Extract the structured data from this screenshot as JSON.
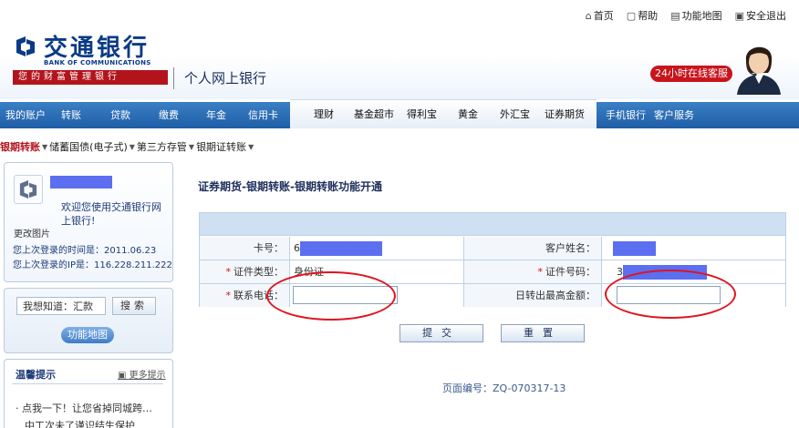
{
  "toplinks": [
    {
      "icon": "home-icon",
      "glyph": "⌂",
      "label": "首页"
    },
    {
      "icon": "help-icon",
      "glyph": "▢",
      "label": "帮助"
    },
    {
      "icon": "map-icon",
      "glyph": "▤",
      "label": "功能地图"
    },
    {
      "icon": "logout-icon",
      "glyph": "▣",
      "label": "安全退出"
    }
  ],
  "brand": {
    "name_cn": "交通银行",
    "name_en": "BANK OF COMMUNICATIONS",
    "slogan": "您的财富管理银行",
    "site_title": "个人网上银行",
    "online_service": "24小时在线客服",
    "brand_color": "#0a3a86",
    "accent_color": "#c8141c"
  },
  "nav": {
    "left": [
      "我的账户",
      "转账",
      "贷款",
      "缴费",
      "年金",
      "信用卡"
    ],
    "mid": [
      "理财",
      "基金超市",
      "得利宝",
      "黄金",
      "外汇宝",
      "证券期货"
    ],
    "right": [
      "手机银行",
      "客户服务"
    ]
  },
  "subnav": [
    {
      "label": "银期转账",
      "active": true
    },
    {
      "label": "储蓄国债(电子式)",
      "active": false
    },
    {
      "label": "第三方存管",
      "active": false
    },
    {
      "label": "银期证转账",
      "active": false
    }
  ],
  "user_panel": {
    "username_masked": "████",
    "welcome": "欢迎您使用交通银行网上银行!",
    "change_picture": "更改图片",
    "last_login_time": "您上次登录的时间是：2011.06.23",
    "last_login_ip": "您上次登录的IP是：116.228.211.222"
  },
  "search": {
    "input_value": "我想知道：汇款",
    "button_label": "搜索",
    "func_map_label": "功能地图"
  },
  "tips": {
    "title": "温馨提示",
    "more": "更多提示",
    "items": [
      "点我一下！让您省掉同城跨…",
      "中工次未了谨识结生保护"
    ]
  },
  "page": {
    "heading": "证券期货-银期转账-银期转账功能开通",
    "code": "页面编号：ZQ-070317-13"
  },
  "form": {
    "card_label": "卡号：",
    "card_value": "6",
    "card_masked": "████████████",
    "customer_label": "客户姓名：",
    "customer_masked": "██████",
    "id_type_label": "证件类型：",
    "id_type_value": "身份证",
    "id_no_label": "证件号码：",
    "id_no_value": "3",
    "id_no_masked": "████████████",
    "phone_label": "联系电话：",
    "phone_value": "",
    "daily_limit_label": "日转出最高金额：",
    "daily_limit_value": "",
    "required_mark": "*",
    "submit": "提交",
    "reset": "重置"
  }
}
